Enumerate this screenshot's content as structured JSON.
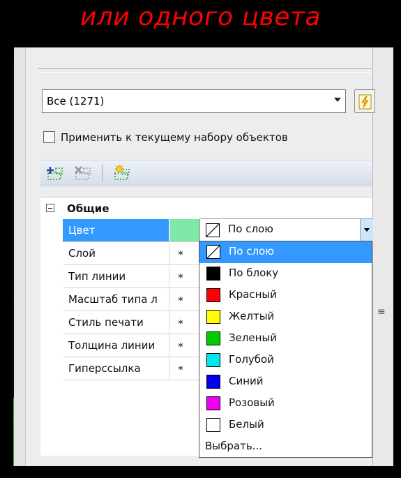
{
  "banner": {
    "title": "или одного цвета",
    "color": "#ff0000"
  },
  "selector": {
    "value": "Все (1271)"
  },
  "apply_to_selection": {
    "label": "Применить к текущему набору объектов",
    "checked": false
  },
  "toolbar": {
    "icons": [
      "add-to-set-icon",
      "remove-from-set-icon",
      "quick-select-icon"
    ]
  },
  "category": {
    "label": "Общие",
    "expanded": true
  },
  "properties": [
    {
      "name": "Цвет",
      "value_label": "По слою",
      "selected": true,
      "swatch_color": "#7ee8a6"
    },
    {
      "name": "Слой",
      "value_label": "*"
    },
    {
      "name": "Тип линии",
      "value_label": "*"
    },
    {
      "name": "Масштаб типа л",
      "value_label": "*"
    },
    {
      "name": "Стиль печати",
      "value_label": "*"
    },
    {
      "name": "Толщина линии",
      "value_label": "*"
    },
    {
      "name": "Гиперссылка",
      "value_label": "*"
    }
  ],
  "color_combo": {
    "value": "По слою"
  },
  "color_options": [
    {
      "label": "По слою",
      "color": "bylayer",
      "highlighted": true
    },
    {
      "label": "По блоку",
      "color": "#000000"
    },
    {
      "label": "Красный",
      "color": "#ff0000"
    },
    {
      "label": "Желтый",
      "color": "#ffff00"
    },
    {
      "label": "Зеленый",
      "color": "#00cc00"
    },
    {
      "label": "Голубой",
      "color": "#00e5ee"
    },
    {
      "label": "Синий",
      "color": "#0000ee"
    },
    {
      "label": "Розовый",
      "color": "#ee00ee"
    },
    {
      "label": "Белый",
      "color": "#ffffff"
    }
  ],
  "choose_more": {
    "label": "Выбрать..."
  },
  "scroll_grip": {
    "glyph": "≡"
  }
}
